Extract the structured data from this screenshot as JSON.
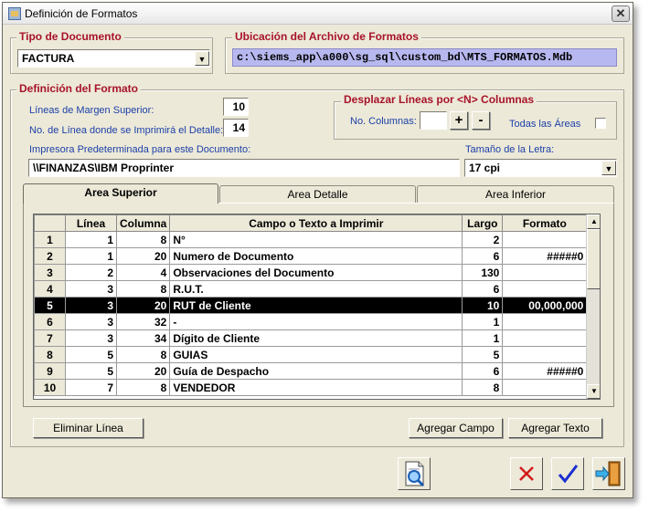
{
  "window": {
    "title": "Definición de Formatos",
    "close_glyph": "✕"
  },
  "tipo_documento": {
    "title": "Tipo de Documento",
    "value": "FACTURA"
  },
  "ubicacion": {
    "title": "Ubicación del Archivo de Formatos",
    "path": "c:\\siems_app\\a000\\sg_sql\\custom_bd\\MTS_FORMATOS.Mdb"
  },
  "definicion": {
    "title": "Definición del Formato",
    "margen_label": "Líneas de Margen Superior:",
    "margen_value": "10",
    "linea_label": "No. de Línea donde se Imprimirá el Detalle:",
    "linea_value": "14",
    "impresora_label": "Impresora Predeterminada para este Documento:",
    "impresora_value": "\\\\FINANZAS\\IBM Proprinter",
    "tamano_label": "Tamaño de la Letra:",
    "tamano_value": "17 cpi"
  },
  "desplazar": {
    "title": "Desplazar Líneas por <N> Columnas",
    "columnas_label": "No. Columnas:",
    "columnas_value": "",
    "plus": "+",
    "minus": "-",
    "todas_label": "Todas las Áreas"
  },
  "tabs": [
    "Area Superior",
    "Area Detalle",
    "Area Inferior"
  ],
  "grid": {
    "headers": [
      "Línea",
      "Columna",
      "Campo o Texto a Imprimir",
      "Largo",
      "Formato"
    ],
    "rows": [
      {
        "n": "1",
        "linea": "1",
        "columna": "8",
        "campo": "N°",
        "largo": "2",
        "formato": ""
      },
      {
        "n": "2",
        "linea": "1",
        "columna": "20",
        "campo": "Numero de Documento",
        "largo": "6",
        "formato": "#####0"
      },
      {
        "n": "3",
        "linea": "2",
        "columna": "4",
        "campo": "Observaciones del Documento",
        "largo": "130",
        "formato": ""
      },
      {
        "n": "4",
        "linea": "3",
        "columna": "8",
        "campo": "R.U.T.",
        "largo": "6",
        "formato": ""
      },
      {
        "n": "5",
        "linea": "3",
        "columna": "20",
        "campo": "RUT de Cliente",
        "largo": "10",
        "formato": "00,000,000"
      },
      {
        "n": "6",
        "linea": "3",
        "columna": "32",
        "campo": "-",
        "largo": "1",
        "formato": ""
      },
      {
        "n": "7",
        "linea": "3",
        "columna": "34",
        "campo": "Dígito de Cliente",
        "largo": "1",
        "formato": ""
      },
      {
        "n": "8",
        "linea": "5",
        "columna": "8",
        "campo": "GUIAS",
        "largo": "5",
        "formato": ""
      },
      {
        "n": "9",
        "linea": "5",
        "columna": "20",
        "campo": "Guía de Despacho",
        "largo": "6",
        "formato": "#####0"
      },
      {
        "n": "10",
        "linea": "7",
        "columna": "8",
        "campo": "VENDEDOR",
        "largo": "8",
        "formato": ""
      }
    ],
    "selected_row": 5
  },
  "buttons": {
    "eliminar": "Eliminar Línea",
    "agregar_campo": "Agregar Campo",
    "agregar_texto": "Agregar Texto"
  },
  "icons": {
    "preview": "preview-document-icon",
    "cancel": "red-x-icon",
    "accept": "checkmark-icon",
    "exit": "exit-door-icon"
  },
  "colors": {
    "group_title": "#a8132a",
    "label": "#1b3fa8",
    "path_bg": "#b8b8f0",
    "selected_row": "#000000"
  }
}
